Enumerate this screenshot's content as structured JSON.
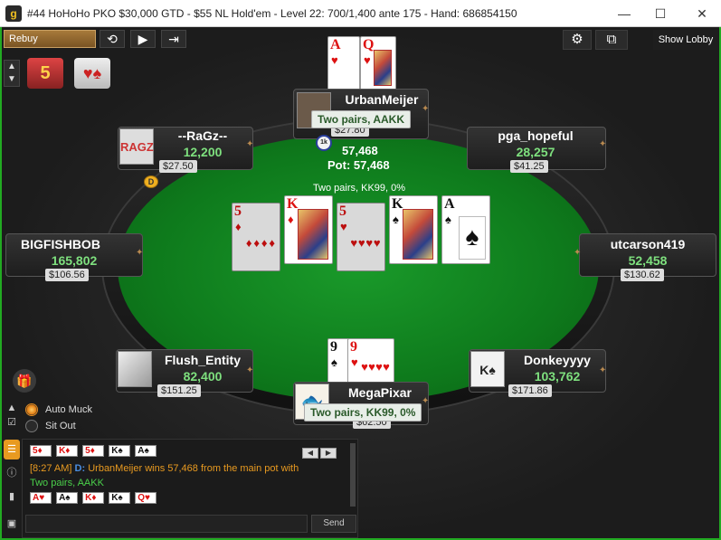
{
  "window": {
    "title": "#44 HoHoHo PKO $30,000 GTD - $55 NL Hold'em - Level 22: 700/1,400 ante 175 - Hand: 686854150",
    "app_icon": "g",
    "minimize": "—",
    "maximize": "☐",
    "close": "✕"
  },
  "toolbar": {
    "rebuy": "Rebuy",
    "refresh_icon": "⟲",
    "play_icon": "▶",
    "exit_icon": "⇥",
    "settings_icon": "⚙",
    "layout_icon": "⧉",
    "show_lobby": "Show Lobby"
  },
  "pot": {
    "chip_label": "1k",
    "amount": "57,468",
    "total": "Pot: 57,468",
    "hand_desc": "Two pairs, KK99, 0%"
  },
  "board": [
    {
      "rank": "5",
      "suit": "♦",
      "color": "red"
    },
    {
      "rank": "K",
      "suit": "♦",
      "color": "red"
    },
    {
      "rank": "5",
      "suit": "♥",
      "color": "red"
    },
    {
      "rank": "K",
      "suit": "♠",
      "color": "black"
    },
    {
      "rank": "A",
      "suit": "♠",
      "color": "black"
    }
  ],
  "top_hole_cards": [
    {
      "rank": "A",
      "suit": "♥",
      "color": "red"
    },
    {
      "rank": "Q",
      "suit": "♥",
      "color": "red"
    }
  ],
  "hero_hole_cards": [
    {
      "rank": "9",
      "suit": "♠",
      "color": "black"
    },
    {
      "rank": "9",
      "suit": "♥",
      "color": "red"
    }
  ],
  "dealer_button": "D",
  "players": {
    "top": {
      "name": "UrbanMeijer",
      "result": "Two pairs, AAKK",
      "bounty": "$27.80"
    },
    "top_left": {
      "name": "--RaGz--",
      "stack": "12,200",
      "bounty": "$27.50",
      "avatar": "RAGZ"
    },
    "top_right": {
      "name": "pga_hopeful",
      "stack": "28,257",
      "bounty": "$41.25"
    },
    "left": {
      "name": "BIGFISHBOB",
      "stack": "165,802",
      "bounty": "$106.56"
    },
    "right": {
      "name": "utcarson419",
      "stack": "52,458",
      "bounty": "$130.62"
    },
    "bottom_left": {
      "name": "Flush_Entity",
      "stack": "82,400",
      "bounty": "$151.25"
    },
    "bottom_right": {
      "name": "Donkeyyyy",
      "stack": "103,762",
      "bounty": "$171.86",
      "avatar": "K♠"
    },
    "hero": {
      "name": "MegaPixar",
      "result": "Two pairs, KK99, 0%",
      "bounty": "$62.50"
    }
  },
  "options": {
    "auto_muck": "Auto Muck",
    "sit_out": "Sit Out"
  },
  "chat": {
    "line1_cards": [
      {
        "rank": "5",
        "suit": "♦",
        "color": "red"
      },
      {
        "rank": "K",
        "suit": "♦",
        "color": "red"
      },
      {
        "rank": "5",
        "suit": "♦",
        "color": "red"
      },
      {
        "rank": "K",
        "suit": "♠",
        "color": "black"
      },
      {
        "rank": "A",
        "suit": "♠",
        "color": "black"
      }
    ],
    "time": "[8:27 AM]",
    "player": "UrbanMeijer",
    "win_text": "wins 57,468",
    "from_text": "from the main pot with",
    "hand_text": "Two pairs, AAKK",
    "line4_cards": [
      {
        "rank": "A",
        "suit": "♥",
        "color": "red"
      },
      {
        "rank": "A",
        "suit": "♠",
        "color": "black"
      },
      {
        "rank": "K",
        "suit": "♦",
        "color": "red"
      },
      {
        "rank": "K",
        "suit": "♠",
        "color": "black"
      },
      {
        "rank": "Q",
        "suit": "♥",
        "color": "red"
      }
    ],
    "send": "Send"
  }
}
